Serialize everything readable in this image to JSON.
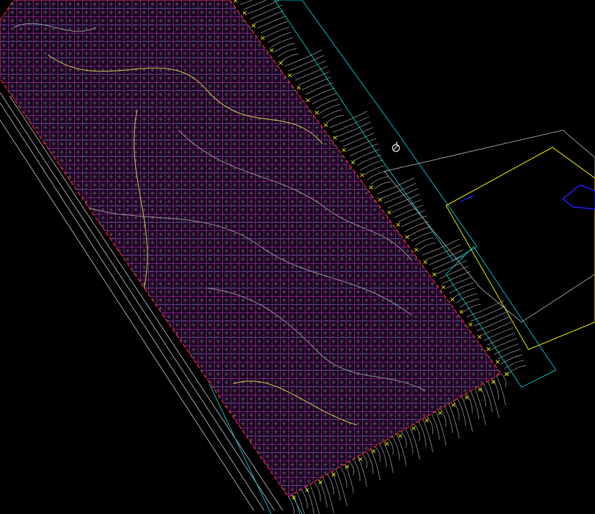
{
  "drawing": {
    "background_color": "#000000",
    "grid_color": "#e040e0",
    "grid_accent_color": "#00ffff",
    "contour_color": "#9a9a9a",
    "contour_highlight_color": "#d8d850",
    "boundary_color": "#ff3030",
    "marker_color": "#ffff00",
    "frame_color": "#00c8c8",
    "road_line_color": "#b0b0b0",
    "pond_outline_color": "#ffff00",
    "pond_frame_color": "#a0a0a0",
    "water_color": "#2020ff",
    "marker_glyph": "×",
    "survey_marker_icon": "survey-point-icon"
  }
}
